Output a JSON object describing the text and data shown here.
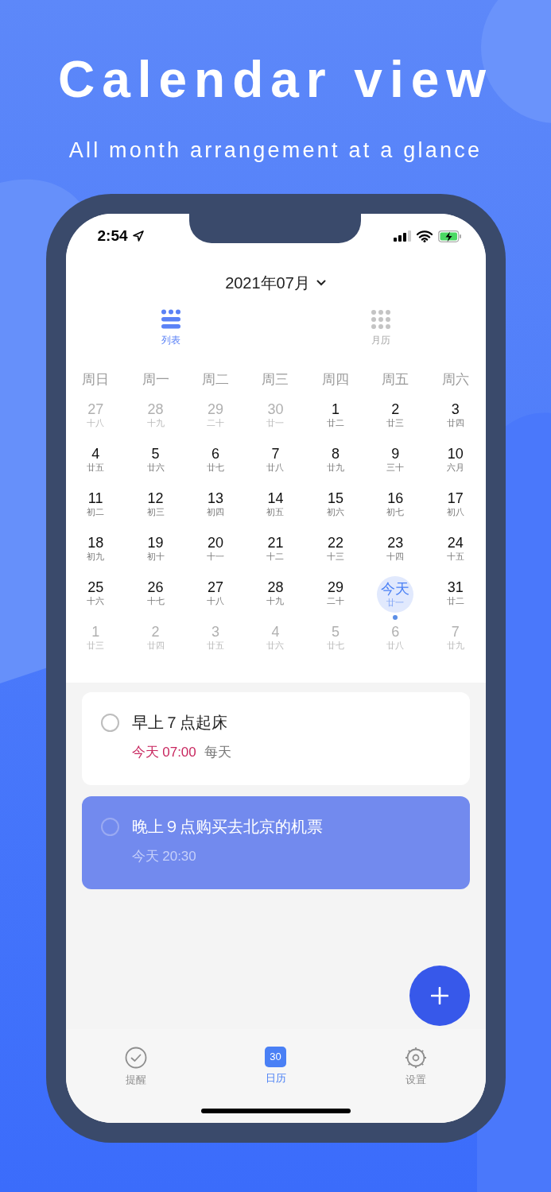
{
  "headline": "Calendar view",
  "subtitle": "All month arrangement at a glance",
  "status_bar": {
    "time": "2:54"
  },
  "month_picker": {
    "label": "2021年07月"
  },
  "view_tabs": [
    {
      "kind": "list",
      "label": "列表",
      "selected": true
    },
    {
      "kind": "grid",
      "label": "月历",
      "selected": false
    }
  ],
  "weekdays": [
    "周日",
    "周一",
    "周二",
    "周三",
    "周四",
    "周五",
    "周六"
  ],
  "weeks": [
    [
      {
        "day": "27",
        "lunar": "十八",
        "kind": "muted"
      },
      {
        "day": "28",
        "lunar": "十九",
        "kind": "muted"
      },
      {
        "day": "29",
        "lunar": "二十",
        "kind": "muted"
      },
      {
        "day": "30",
        "lunar": "廿一",
        "kind": "muted"
      },
      {
        "day": "1",
        "lunar": "廿二",
        "kind": "normal"
      },
      {
        "day": "2",
        "lunar": "廿三",
        "kind": "normal"
      },
      {
        "day": "3",
        "lunar": "廿四",
        "kind": "normal"
      }
    ],
    [
      {
        "day": "4",
        "lunar": "廿五",
        "kind": "normal"
      },
      {
        "day": "5",
        "lunar": "廿六",
        "kind": "normal"
      },
      {
        "day": "6",
        "lunar": "廿七",
        "kind": "normal"
      },
      {
        "day": "7",
        "lunar": "廿八",
        "kind": "normal"
      },
      {
        "day": "8",
        "lunar": "廿九",
        "kind": "normal"
      },
      {
        "day": "9",
        "lunar": "三十",
        "kind": "normal"
      },
      {
        "day": "10",
        "lunar": "六月",
        "kind": "normal"
      }
    ],
    [
      {
        "day": "11",
        "lunar": "初二",
        "kind": "normal"
      },
      {
        "day": "12",
        "lunar": "初三",
        "kind": "normal"
      },
      {
        "day": "13",
        "lunar": "初四",
        "kind": "normal"
      },
      {
        "day": "14",
        "lunar": "初五",
        "kind": "normal"
      },
      {
        "day": "15",
        "lunar": "初六",
        "kind": "normal"
      },
      {
        "day": "16",
        "lunar": "初七",
        "kind": "normal"
      },
      {
        "day": "17",
        "lunar": "初八",
        "kind": "normal"
      }
    ],
    [
      {
        "day": "18",
        "lunar": "初九",
        "kind": "normal"
      },
      {
        "day": "19",
        "lunar": "初十",
        "kind": "normal"
      },
      {
        "day": "20",
        "lunar": "十一",
        "kind": "normal"
      },
      {
        "day": "21",
        "lunar": "十二",
        "kind": "normal"
      },
      {
        "day": "22",
        "lunar": "十三",
        "kind": "normal"
      },
      {
        "day": "23",
        "lunar": "十四",
        "kind": "normal"
      },
      {
        "day": "24",
        "lunar": "十五",
        "kind": "normal"
      }
    ],
    [
      {
        "day": "25",
        "lunar": "十六",
        "kind": "normal"
      },
      {
        "day": "26",
        "lunar": "十七",
        "kind": "normal"
      },
      {
        "day": "27",
        "lunar": "十八",
        "kind": "normal"
      },
      {
        "day": "28",
        "lunar": "十九",
        "kind": "normal"
      },
      {
        "day": "29",
        "lunar": "二十",
        "kind": "normal"
      },
      {
        "day": "今天",
        "lunar": "廿一",
        "kind": "today"
      },
      {
        "day": "31",
        "lunar": "廿二",
        "kind": "normal"
      }
    ],
    [
      {
        "day": "1",
        "lunar": "廿三",
        "kind": "muted"
      },
      {
        "day": "2",
        "lunar": "廿四",
        "kind": "muted"
      },
      {
        "day": "3",
        "lunar": "廿五",
        "kind": "muted"
      },
      {
        "day": "4",
        "lunar": "廿六",
        "kind": "muted"
      },
      {
        "day": "5",
        "lunar": "廿七",
        "kind": "muted"
      },
      {
        "day": "6",
        "lunar": "廿八",
        "kind": "muted"
      },
      {
        "day": "7",
        "lunar": "廿九",
        "kind": "muted"
      }
    ]
  ],
  "reminders": [
    {
      "title": "早上７点起床",
      "time": "今天 07:00",
      "repeat": "每天",
      "selected": false,
      "checked": false
    },
    {
      "title": "晚上９点购买去北京的机票",
      "time": "今天 20:30",
      "selected": true,
      "checked": false
    }
  ],
  "bottom_tabs": [
    {
      "kind": "check",
      "label": "提醒",
      "selected": false
    },
    {
      "kind": "calendar",
      "label": "日历",
      "icon_text": "30",
      "selected": true
    },
    {
      "kind": "gear",
      "label": "设置",
      "selected": false
    }
  ]
}
